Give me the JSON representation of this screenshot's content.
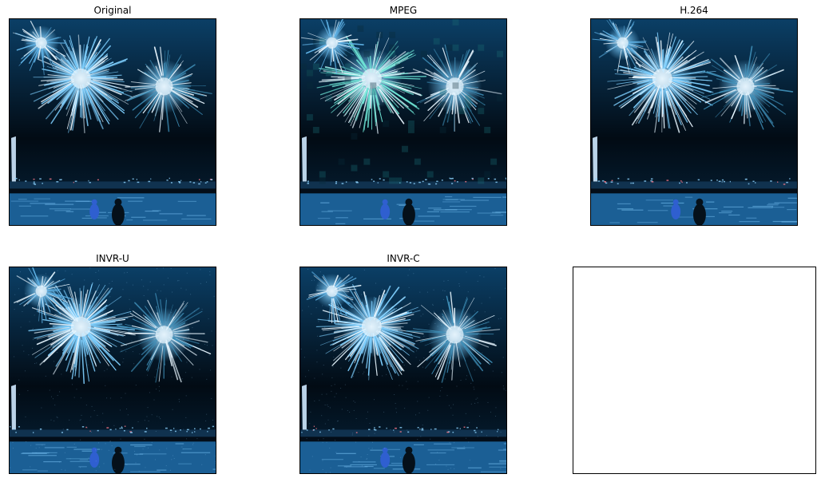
{
  "figure": {
    "panels": [
      {
        "id": "original",
        "title": "Original",
        "content": "fireworks-over-water-image"
      },
      {
        "id": "mpeg",
        "title": "MPEG",
        "content": "fireworks-over-water-image"
      },
      {
        "id": "h264",
        "title": "H.264",
        "content": "fireworks-over-water-image"
      },
      {
        "id": "invr-u",
        "title": "INVR-U",
        "content": "fireworks-over-water-image"
      },
      {
        "id": "invr-c",
        "title": "INVR-C",
        "content": "fireworks-over-water-image"
      },
      {
        "id": "empty",
        "title": "",
        "content": "empty-axes"
      }
    ],
    "colors": {
      "sky_top": "#0b3f66",
      "sky_bottom": "#020b14",
      "firework_core": "#e8f6ff",
      "firework_mid": "#7fd0ff",
      "firework_teal": "#6fe6d6",
      "water": "#1b5f95",
      "shoreline_lights": "#8fd4ff",
      "figure_blue": "#2f5fd0"
    }
  }
}
